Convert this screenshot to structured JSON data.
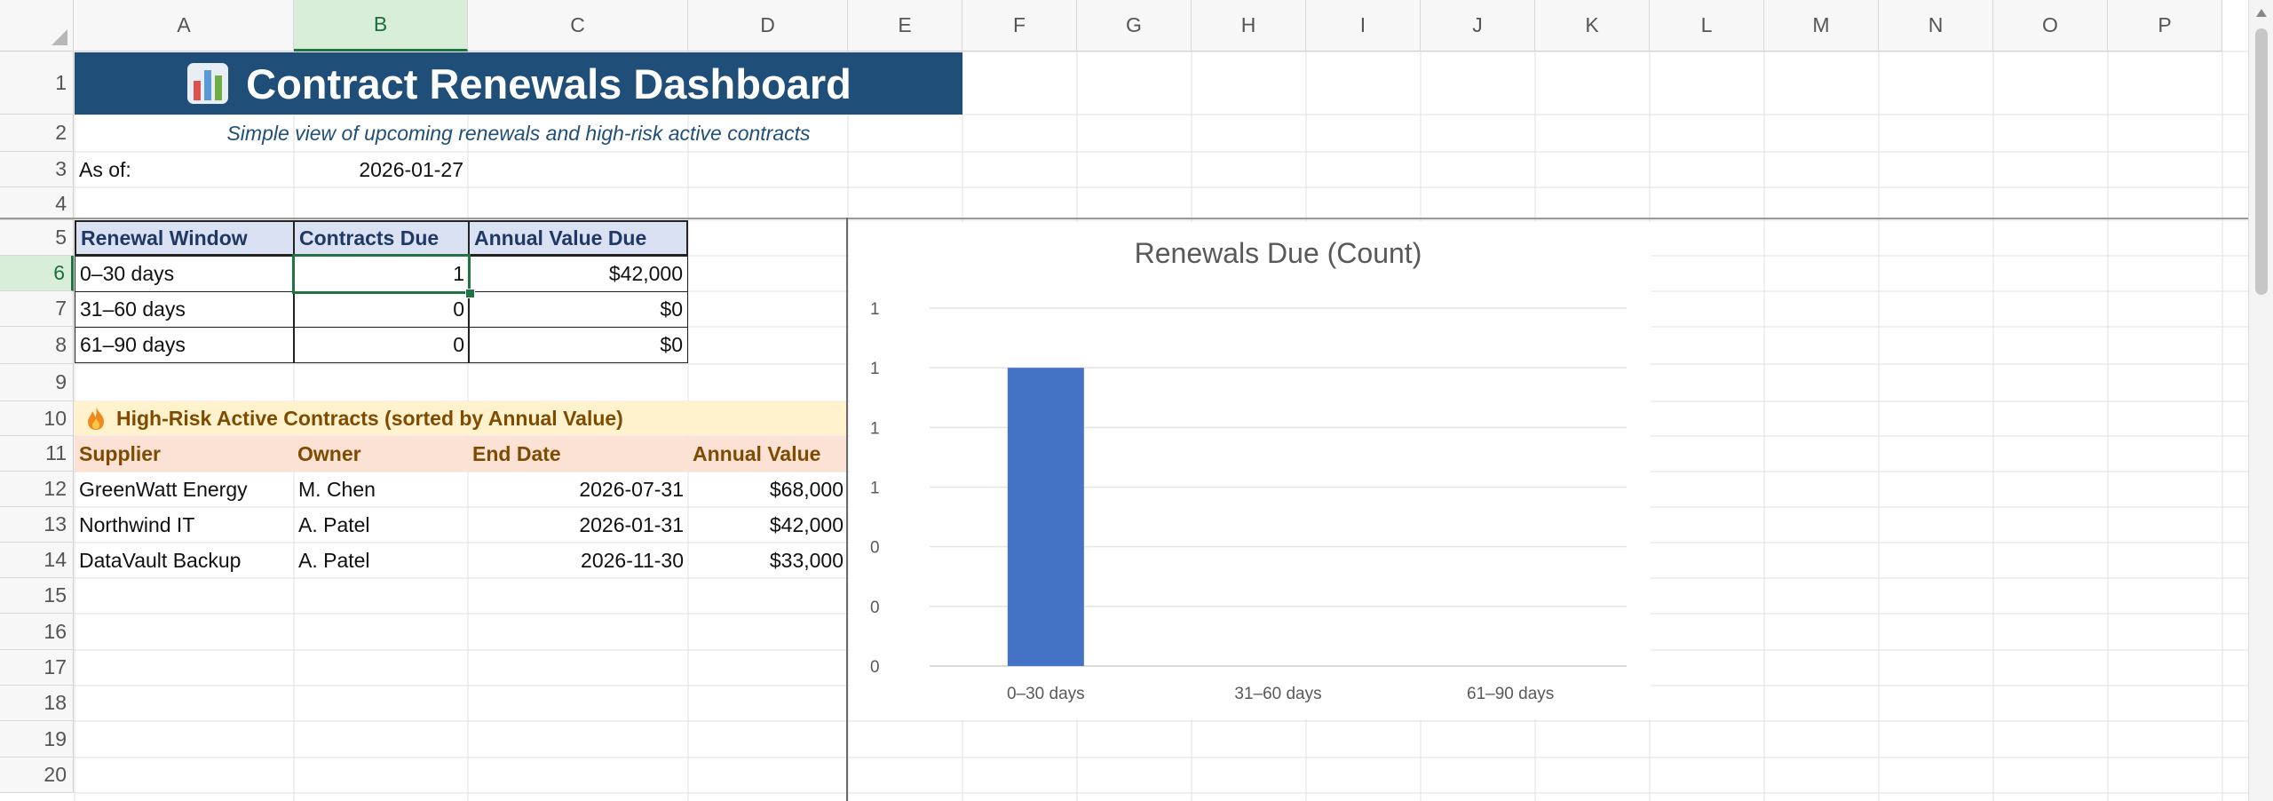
{
  "columns": [
    "A",
    "B",
    "C",
    "D",
    "E",
    "F",
    "G",
    "H",
    "I",
    "J",
    "K",
    "L",
    "M",
    "N",
    "O",
    "P"
  ],
  "rows": [
    "1",
    "2",
    "3",
    "4",
    "5",
    "6",
    "7",
    "8",
    "9",
    "10",
    "11",
    "12",
    "13",
    "14",
    "15",
    "16",
    "17",
    "18",
    "19",
    "20"
  ],
  "selected_cell": "B6",
  "title": "Contract Renewals Dashboard",
  "title_icon": "bar-chart-icon",
  "subtitle": "Simple view of upcoming renewals and high-risk active contracts",
  "as_of": {
    "label": "As of:",
    "value": "2026-01-27"
  },
  "renewals_table": {
    "headers": [
      "Renewal Window",
      "Contracts Due",
      "Annual Value Due"
    ],
    "rows": [
      [
        "0–30 days",
        "1",
        "$42,000"
      ],
      [
        "31–60 days",
        "0",
        "$0"
      ],
      [
        "61–90 days",
        "0",
        "$0"
      ]
    ]
  },
  "high_risk": {
    "icon": "fire-icon",
    "title": "High-Risk Active Contracts (sorted by Annual Value)",
    "headers": [
      "Supplier",
      "Owner",
      "End Date",
      "Annual Value"
    ],
    "rows": [
      [
        "GreenWatt Energy",
        "M. Chen",
        "2026-07-31",
        "$68,000"
      ],
      [
        "Northwind IT",
        "A. Patel",
        "2026-01-31",
        "$42,000"
      ],
      [
        "DataVault Backup",
        "A. Patel",
        "2026-11-30",
        "$33,000"
      ]
    ]
  },
  "colors": {
    "title_band": "#1f4e79",
    "bar": "#4472c4",
    "header_blue": "#d9e1f2",
    "header_orange": "#fbe2d5",
    "band_yellow": "#fff2cc",
    "selection": "#217346"
  },
  "chart_data": {
    "type": "bar",
    "title": "Renewals Due (Count)",
    "categories": [
      "0–30 days",
      "31–60 days",
      "61–90 days"
    ],
    "values": [
      1,
      0,
      0
    ],
    "ylim": [
      0,
      1.2
    ],
    "y_tick_labels": [
      "0",
      "0",
      "0",
      "1",
      "1",
      "1",
      "1"
    ],
    "bar_color": "#4472c4",
    "grid": true,
    "legend": "none"
  }
}
